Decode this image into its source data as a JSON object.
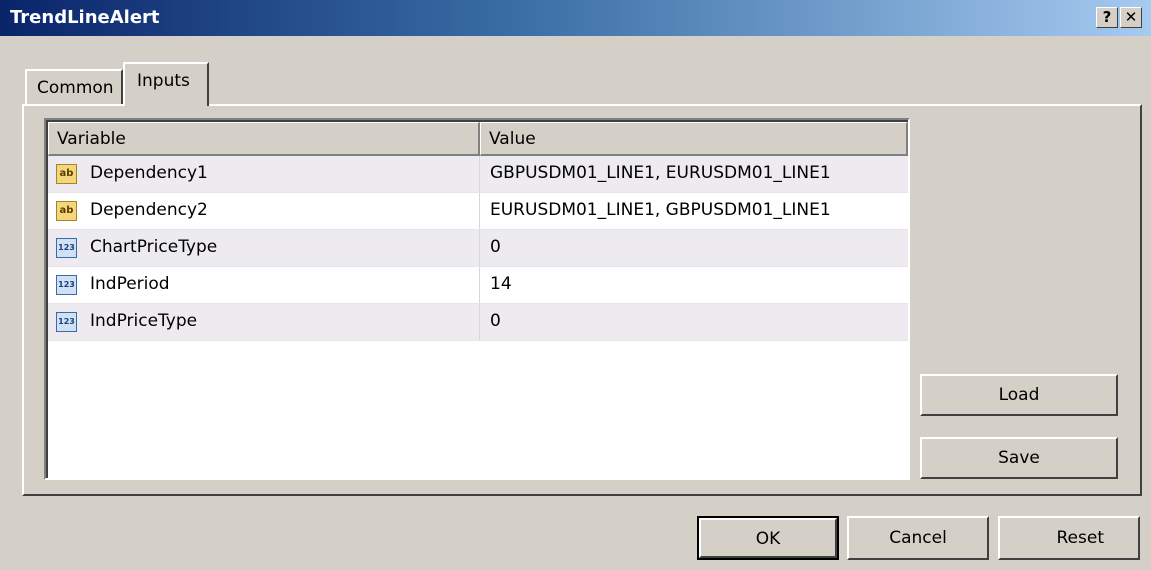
{
  "window": {
    "title": "TrendLineAlert",
    "help_label": "?",
    "close_label": "✕"
  },
  "tabs": [
    {
      "label": "Common",
      "active": false
    },
    {
      "label": "Inputs",
      "active": true
    }
  ],
  "table": {
    "columns": [
      "Variable",
      "Value"
    ],
    "rows": [
      {
        "type": "ab",
        "icon": "string-type-icon",
        "variable": "Dependency1",
        "value": "GBPUSDM01_LINE1, EURUSDM01_LINE1"
      },
      {
        "type": "ab",
        "icon": "string-type-icon",
        "variable": "Dependency2",
        "value": "EURUSDM01_LINE1, GBPUSDM01_LINE1"
      },
      {
        "type": "123",
        "icon": "integer-type-icon",
        "variable": "ChartPriceType",
        "value": "0"
      },
      {
        "type": "123",
        "icon": "integer-type-icon",
        "variable": "IndPeriod",
        "value": "14"
      },
      {
        "type": "123",
        "icon": "integer-type-icon",
        "variable": "IndPriceType",
        "value": "0"
      }
    ]
  },
  "side_buttons": {
    "load": "Load",
    "save": "Save"
  },
  "footer": {
    "ok": "OK",
    "cancel": "Cancel",
    "reset": "Reset"
  }
}
